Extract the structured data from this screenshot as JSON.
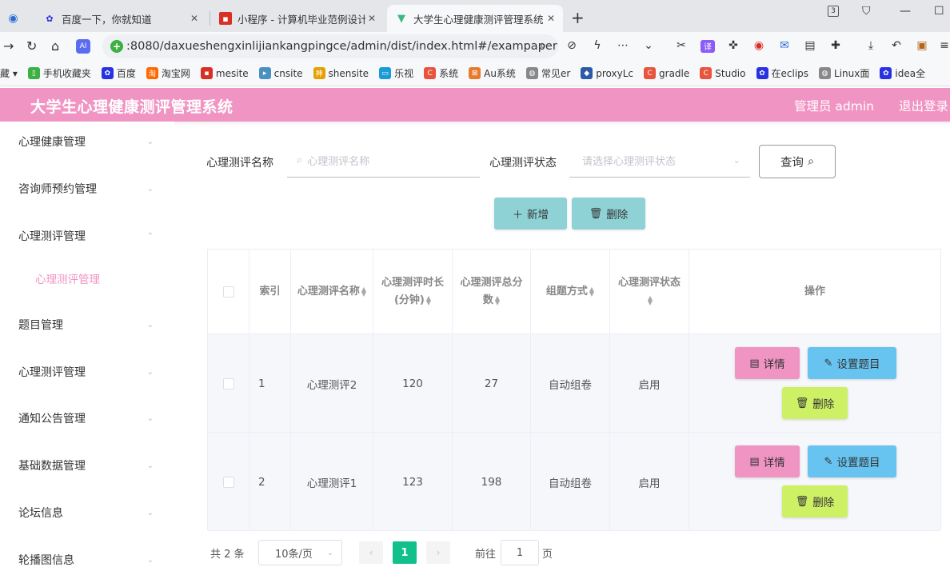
{
  "browser": {
    "tabs": [
      {
        "label": "百度一下，你就知道",
        "icon": "paw-icon"
      },
      {
        "label": "小程序 - 计算机毕业范例设计",
        "icon": "red-square-icon"
      },
      {
        "label": "大学生心理健康测评管理系统",
        "icon": "vue-icon"
      }
    ],
    "tab_count_badge": "3",
    "url": ":8080/daxueshengxinlijiankangpingce/admin/dist/index.html#/exampaper",
    "bookmarks": [
      {
        "label": "藏",
        "color": "#555555"
      },
      {
        "label": "手机收藏夹",
        "color": "#3cb043"
      },
      {
        "label": "百度",
        "color": "#2932e1"
      },
      {
        "label": "淘宝网",
        "color": "#ff6a00"
      },
      {
        "label": "mesite",
        "color": "#d93025"
      },
      {
        "label": "cnsite",
        "color": "#4a90c2"
      },
      {
        "label": "shensite",
        "color": "#e6a000"
      },
      {
        "label": "乐视",
        "color": "#1a9ad6"
      },
      {
        "label": "系统",
        "color": "#e8543c"
      },
      {
        "label": "Au系统",
        "color": "#e87a2c"
      },
      {
        "label": "常见er",
        "color": "#888888"
      },
      {
        "label": "proxyLc",
        "color": "#2b5aa8"
      },
      {
        "label": "gradle",
        "color": "#e8543c"
      },
      {
        "label": "Studio",
        "color": "#e8543c"
      },
      {
        "label": "在eclips",
        "color": "#2932e1"
      },
      {
        "label": "Linux面",
        "color": "#888888"
      },
      {
        "label": "idea全",
        "color": "#2932e1"
      }
    ]
  },
  "header": {
    "title": "大学生心理健康测评管理系统",
    "user": "管理员 admin",
    "logout": "退出登录"
  },
  "sidebar": {
    "items": [
      {
        "label": "心理健康管理"
      },
      {
        "label": "咨询师预约管理"
      },
      {
        "label": "心理测评管理",
        "expanded": true
      },
      {
        "label": "题目管理"
      },
      {
        "label": "心理测评管理"
      },
      {
        "label": "通知公告管理"
      },
      {
        "label": "基础数据管理"
      },
      {
        "label": "论坛信息"
      },
      {
        "label": "轮播图信息"
      }
    ],
    "active_sub": "心理测评管理"
  },
  "search": {
    "name_label": "心理测评名称",
    "name_placeholder": "心理测评名称",
    "status_label": "心理测评状态",
    "status_placeholder": "请选择心理测评状态",
    "query_button": "查询"
  },
  "actions": {
    "add": "新增",
    "delete": "删除"
  },
  "table": {
    "headers": {
      "index": "索引",
      "name": "心理测评名称",
      "duration": "心理测评时长(分钟)",
      "total": "心理测评总分数",
      "mode": "组题方式",
      "status": "心理测评状态",
      "ops": "操作"
    },
    "rows": [
      {
        "index": "1",
        "name": "心理测评2",
        "duration": "120",
        "total": "27",
        "mode": "自动组卷",
        "status": "启用"
      },
      {
        "index": "2",
        "name": "心理测评1",
        "duration": "123",
        "total": "198",
        "mode": "自动组卷",
        "status": "启用"
      }
    ],
    "row_buttons": {
      "detail": "详情",
      "set": "设置题目",
      "delete": "删除"
    }
  },
  "pagination": {
    "total": "共 2 条",
    "page_size": "10条/页",
    "current": "1",
    "goto": "前往",
    "goto_value": "1",
    "page_unit": "页"
  }
}
